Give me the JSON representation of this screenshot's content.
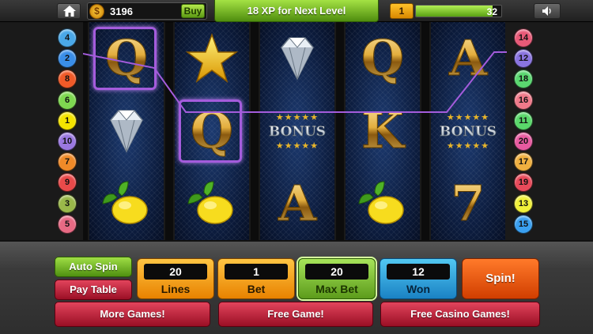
{
  "header": {
    "coins": "3196",
    "buy_label": "Buy",
    "coin_symbol": "$",
    "xp_message": "18 XP for Next Level",
    "level_current": "1",
    "level_next": "32",
    "xp_progress": 0.9
  },
  "paylines": {
    "left": [
      "4",
      "2",
      "8",
      "6",
      "1",
      "10",
      "7",
      "9",
      "3",
      "5"
    ],
    "right": [
      "14",
      "12",
      "18",
      "16",
      "11",
      "20",
      "17",
      "19",
      "13",
      "15"
    ],
    "colors": {
      "1": "#f5e400",
      "2": "#3a8ee8",
      "3": "#9ab84a",
      "4": "#4aa8e8",
      "5": "#e86a84",
      "6": "#7ed850",
      "7": "#f08a28",
      "8": "#f05a28",
      "9": "#e84a4a",
      "10": "#9a78e0",
      "11": "#5ad86a",
      "12": "#8a74e0",
      "13": "#f0f03a",
      "14": "#e85a78",
      "15": "#3aa0f0",
      "16": "#f07a8a",
      "17": "#f0b040",
      "18": "#5ad870",
      "19": "#e84a5a",
      "20": "#e85aa0"
    }
  },
  "reels": [
    [
      "Q",
      "diamond",
      "lemon"
    ],
    [
      "star",
      "Q",
      "lemon"
    ],
    [
      "diamond",
      "BONUS",
      "A"
    ],
    [
      "Q",
      "K",
      "lemon"
    ],
    [
      "A",
      "BONUS",
      "7"
    ]
  ],
  "bonus_stars": "★★★★★",
  "controls": {
    "auto_spin": "Auto Spin",
    "pay_table": "Pay Table",
    "lines_value": "20",
    "lines_label": "Lines",
    "bet_value": "1",
    "bet_label": "Bet",
    "max_bet_value": "20",
    "max_bet_label": "Max Bet",
    "won_value": "12",
    "won_label": "Won",
    "spin": "Spin!",
    "more_games": "More Games!",
    "free_game": "Free Game!",
    "free_casino_games": "Free Casino Games!"
  },
  "colors": {
    "win_frame": "#a45cdc",
    "payline": "#a45cdc"
  }
}
